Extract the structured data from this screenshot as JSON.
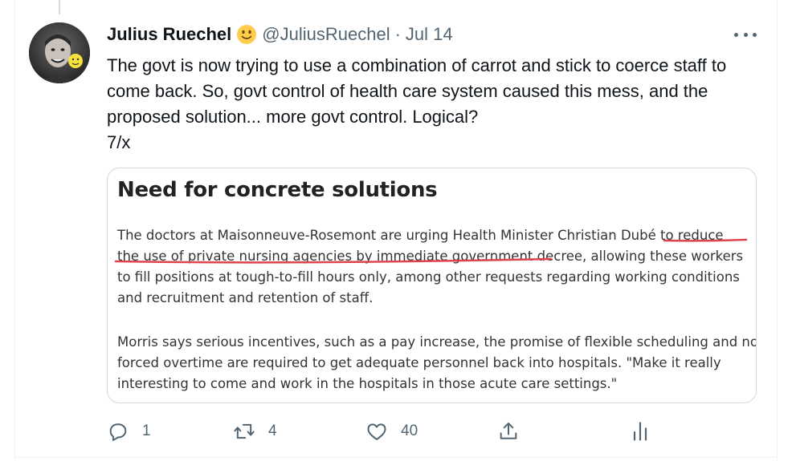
{
  "tweet": {
    "author_name": "Julius Ruechel",
    "name_emoji": "slightly-smiling-face-emoji",
    "handle": "@JuliusRuechel",
    "separator": "·",
    "date": "Jul 14",
    "text": "The govt is now trying to use a combination of carrot and stick to coerce staff to come back. So, govt control of health care system caused this mess, and the proposed solution... more govt control. Logical?\n7/x"
  },
  "card": {
    "title": "Need for concrete solutions",
    "paragraph1": "The doctors at Maisonneuve-Rosemont are urging Health Minister Christian Dubé to reduce the use of private nursing agencies by immediate government decree, allowing these workers to fill positions at tough-to-fill hours only, among other requests regarding working conditions and recruitment and retention of staff.",
    "paragraph2_lines": [
      "Morris says serious incentives, such as a pay increase, the promise of flexible scheduling and no",
      "forced overtime are required to get adequate personnel back into hospitals. \"Make it really",
      "interesting to come and work in the hospitals in those acute care settings.\""
    ],
    "highlight_color": "#e0434c"
  },
  "actions": {
    "reply_count": "1",
    "retweet_count": "4",
    "like_count": "40"
  },
  "icons": [
    "more-icon",
    "reply-icon",
    "retweet-icon",
    "like-icon",
    "share-icon",
    "analytics-icon"
  ],
  "colors": {
    "text": "#0f1419",
    "secondary": "#536471",
    "border": "#cfd9de"
  }
}
